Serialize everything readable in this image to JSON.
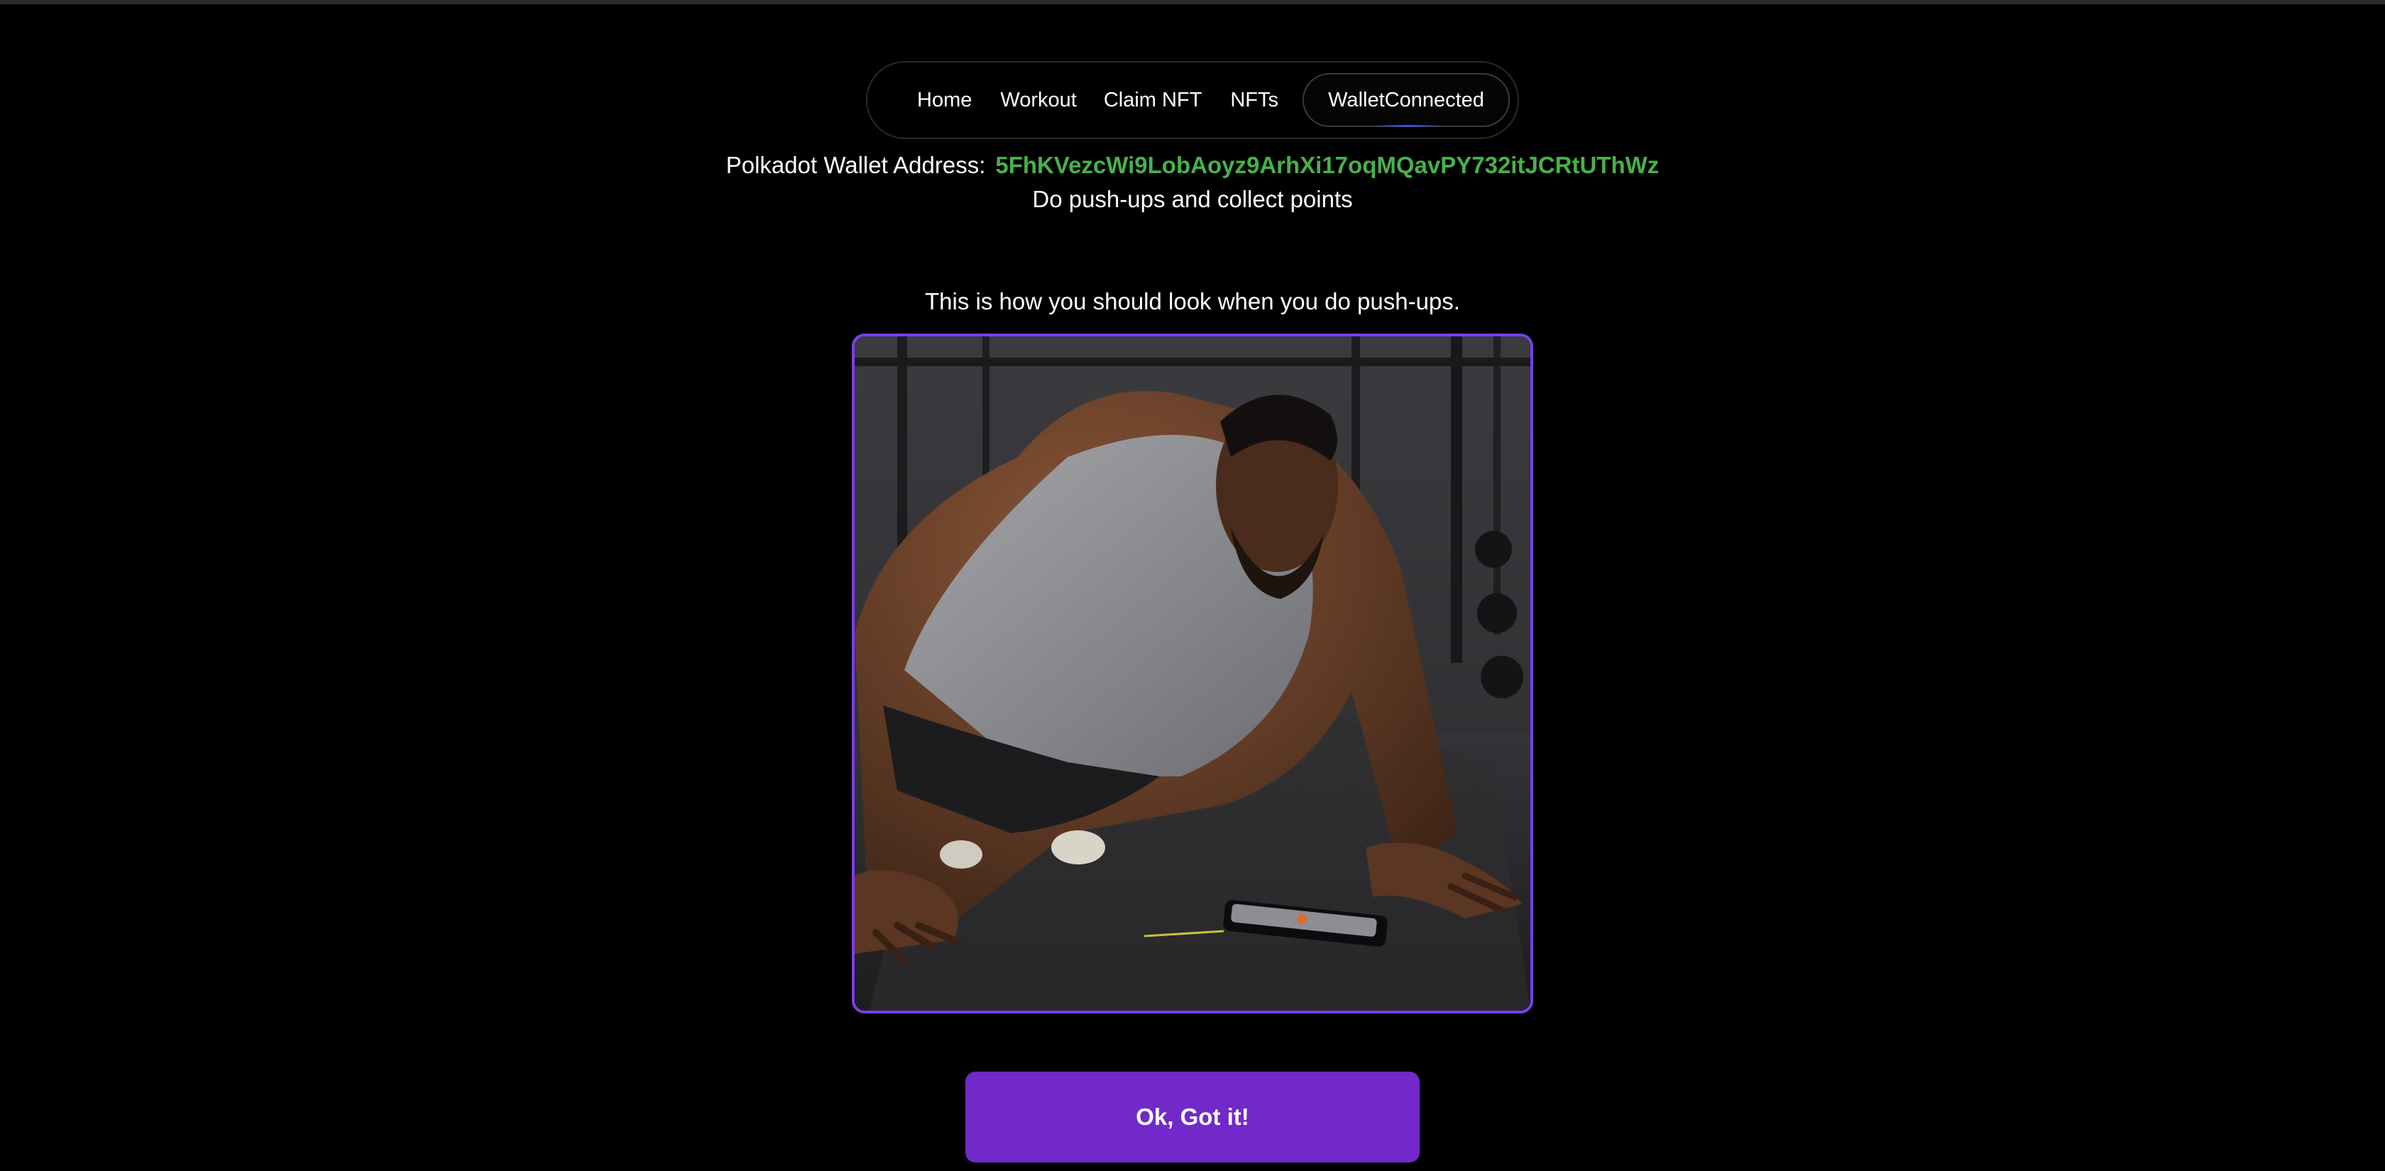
{
  "nav": {
    "items": [
      {
        "label": "Home"
      },
      {
        "label": "Workout"
      },
      {
        "label": "Claim NFT"
      },
      {
        "label": "NFTs"
      }
    ],
    "wallet_button": "WalletConnected"
  },
  "wallet": {
    "label": "Polkadot Wallet Address:",
    "address": "5FhKVezcWi9LobAoyz9ArhXi17oqMQavPY732itJCRtUThWz"
  },
  "page": {
    "subtitle": "Do push-ups and collect points",
    "instruction": "This is how you should look when you do push-ups."
  },
  "image": {
    "alt": "Man doing push-ups in a gym next to a smartphone on the floor"
  },
  "button": {
    "label": "Ok, Got it!"
  },
  "colors": {
    "background": "#000000",
    "accent": "#7129c9",
    "frame_border": "#7b3fe4",
    "address_green": "#48b14a"
  }
}
